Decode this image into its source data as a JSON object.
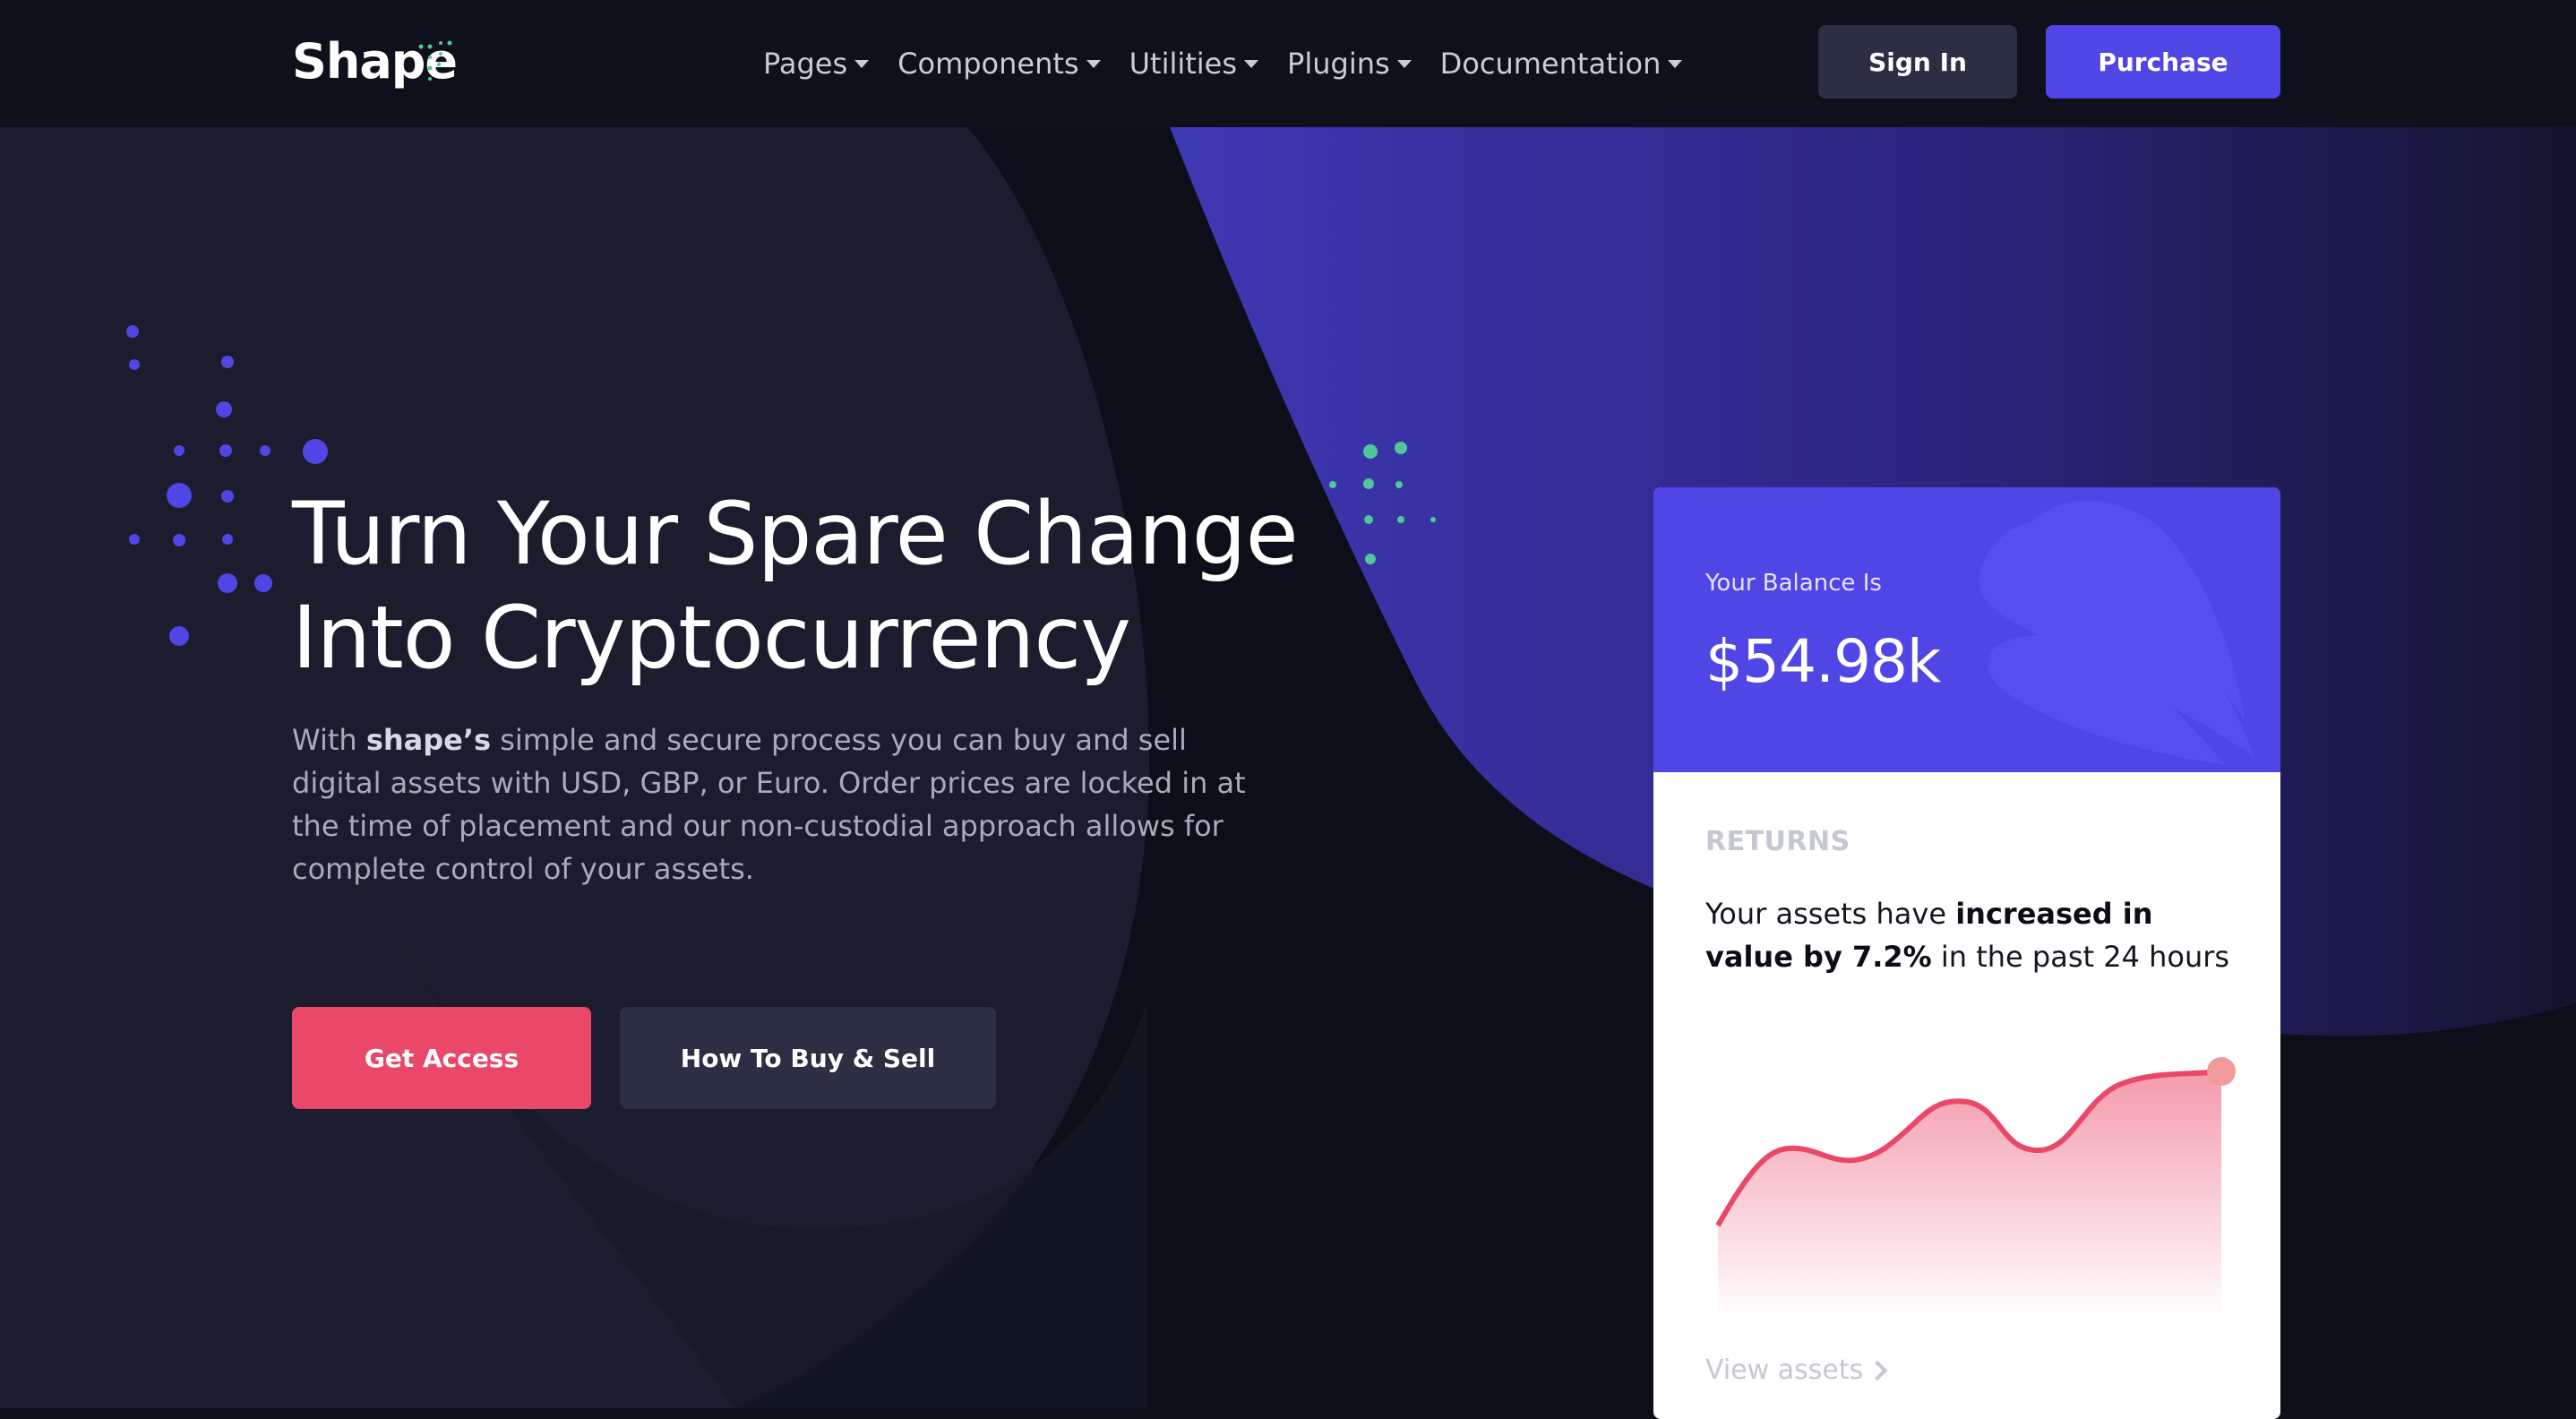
{
  "colors": {
    "background": "#0c0e1a",
    "navbar": "#0e101b",
    "accent_purple": "#5046e5",
    "accent_pink": "#ea4868",
    "dark_button": "#2c2e43",
    "dots_blue": "#5046e5",
    "dots_green": "#4fc79a"
  },
  "brand": {
    "name": "Shape",
    "logo_icon": "sparkle-dots-icon"
  },
  "nav": {
    "items": [
      {
        "label": "Pages"
      },
      {
        "label": "Components"
      },
      {
        "label": "Utilities"
      },
      {
        "label": "Plugins"
      },
      {
        "label": "Documentation"
      }
    ],
    "sign_in": "Sign In",
    "purchase": "Purchase"
  },
  "hero": {
    "title_line1": "Turn Your Spare Change",
    "title_line2": "Into Cryptocurrency",
    "text_prefix": "With ",
    "text_bold": "shape’s",
    "text_rest": " simple and secure process you can buy and sell digital assets with USD, GBP, or Euro. Order prices are locked in at the time of placement and our non-custodial approach allows for complete control of your assets.",
    "primary_button": "Get Access",
    "secondary_button": "How To Buy & Sell"
  },
  "card": {
    "balance_label": "Your Balance Is",
    "balance_value": "$54.98k",
    "returns_label": "RETURNS",
    "returns_prefix": "Your assets have ",
    "returns_bold": "increased in value by 7.2%",
    "returns_suffix": " in the past 24 hours",
    "view_assets": "View assets",
    "decor_icon": "leaf-icon",
    "chart_line_color": "#ea4868"
  }
}
